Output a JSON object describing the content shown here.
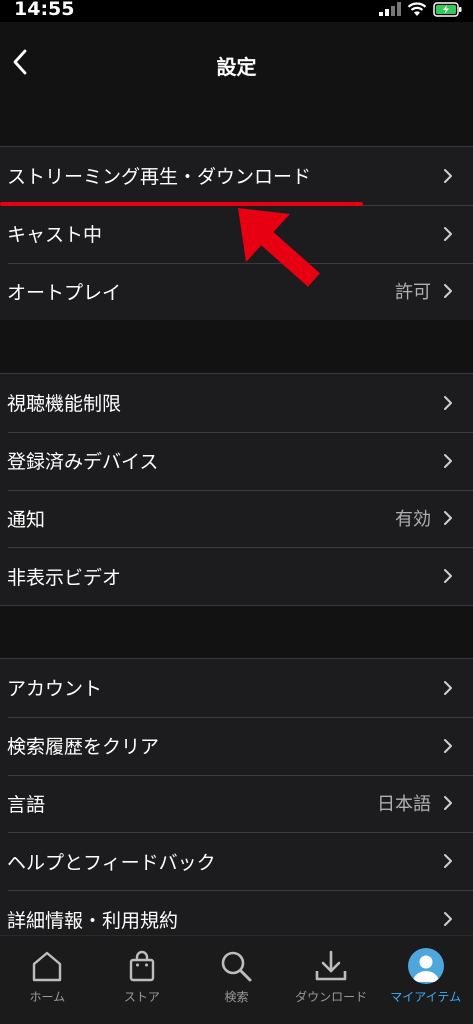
{
  "status_bar": {
    "time": "14:55"
  },
  "header": {
    "title": "設定"
  },
  "groups": [
    {
      "rows": [
        {
          "label": "ストリーミング再生・ダウンロード",
          "value": ""
        },
        {
          "label": "キャスト中",
          "value": ""
        },
        {
          "label": "オートプレイ",
          "value": "許可"
        }
      ]
    },
    {
      "rows": [
        {
          "label": "視聴機能制限",
          "value": ""
        },
        {
          "label": "登録済みデバイス",
          "value": ""
        },
        {
          "label": "通知",
          "value": "有効"
        },
        {
          "label": "非表示ビデオ",
          "value": ""
        }
      ]
    },
    {
      "rows": [
        {
          "label": "アカウント",
          "value": ""
        },
        {
          "label": "検索履歴をクリア",
          "value": ""
        },
        {
          "label": "言語",
          "value": "日本語"
        },
        {
          "label": "ヘルプとフィードバック",
          "value": ""
        },
        {
          "label": "詳細情報・利用規約",
          "value": ""
        }
      ]
    }
  ],
  "tab_bar": {
    "tabs": [
      {
        "label": "ホーム",
        "icon": "home-icon"
      },
      {
        "label": "ストア",
        "icon": "store-bag-icon"
      },
      {
        "label": "検索",
        "icon": "search-icon"
      },
      {
        "label": "ダウンロード",
        "icon": "download-icon"
      },
      {
        "label": "マイアイテム",
        "icon": "avatar-icon"
      }
    ],
    "active_index": 4
  },
  "colors": {
    "background": "#121212",
    "row_background": "#1c1c1e",
    "accent": "#3fa9f5",
    "annotation": "#e60012"
  }
}
